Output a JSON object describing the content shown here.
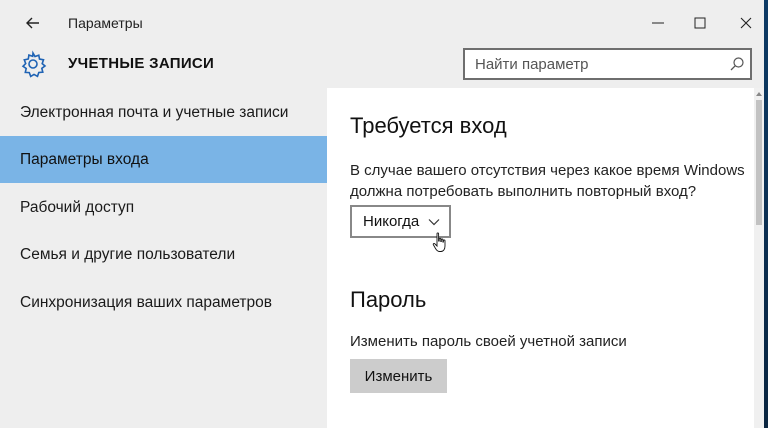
{
  "window": {
    "title": "Параметры"
  },
  "header": {
    "section_title": "УЧЕТНЫЕ ЗАПИСИ",
    "search_placeholder": "Найти параметр"
  },
  "sidebar": {
    "items": [
      {
        "label": "Электронная почта и учетные записи",
        "active": false
      },
      {
        "label": "Параметры входа",
        "active": true
      },
      {
        "label": "Рабочий доступ",
        "active": false
      },
      {
        "label": "Семья и другие пользователи",
        "active": false
      },
      {
        "label": "Синхронизация ваших параметров",
        "active": false
      }
    ]
  },
  "signin": {
    "heading": "Требуется вход",
    "description": "В случае вашего отсутствия через какое время Windows должна потребовать выполнить повторный вход?",
    "dropdown_value": "Никогда"
  },
  "password": {
    "heading": "Пароль",
    "description": "Изменить пароль своей учетной записи",
    "button_label": "Изменить"
  },
  "colors": {
    "accent": "#7ab4e6",
    "chrome_bg": "#eeeeee",
    "button_bg": "#cccccc"
  },
  "icons": [
    "back-arrow-icon",
    "minimize-icon",
    "maximize-icon",
    "close-icon",
    "gear-icon",
    "search-icon",
    "chevron-down-icon",
    "hand-cursor-icon"
  ]
}
